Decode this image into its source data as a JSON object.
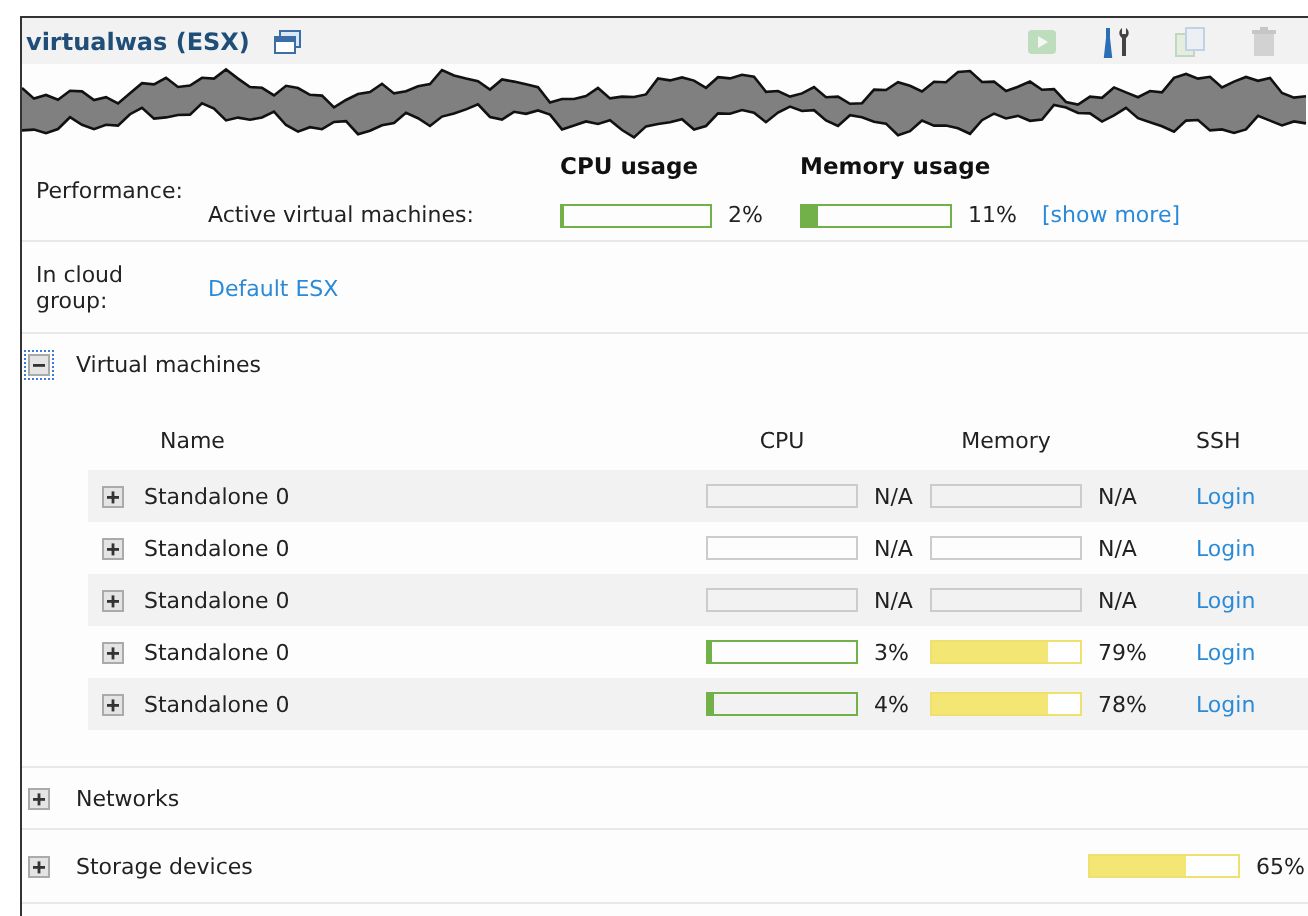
{
  "title": "virtualwas (ESX)",
  "toolbar": [
    {
      "kind": "play",
      "disabled": true
    },
    {
      "kind": "tools",
      "disabled": false
    },
    {
      "kind": "clone",
      "disabled": true
    },
    {
      "kind": "delete",
      "disabled": true
    }
  ],
  "performance": {
    "label": "Performance:",
    "row_label": "Active virtual machines:",
    "cpu": {
      "heading": "CPU usage",
      "level": 0.02,
      "reading": "2%"
    },
    "memory": {
      "heading": "Memory usage",
      "level": 0.11,
      "reading": "11%"
    },
    "link": "[show more]"
  },
  "cloud_group": {
    "label": "In cloud group:",
    "value": "Default ESX"
  },
  "sections": [
    {
      "title": "Virtual machines",
      "expanded": true,
      "table": {
        "columns": [
          "Name",
          "CPU",
          "Memory",
          "SSH"
        ],
        "rows": [
          {
            "name": "Standalone 0",
            "expanded": false,
            "cpu": {
              "reading": "N/A"
            },
            "memory": {
              "reading": "N/A"
            },
            "ssh": "Login"
          },
          {
            "name": "Standalone 0",
            "expanded": false,
            "cpu": {
              "reading": "N/A"
            },
            "memory": {
              "reading": "N/A"
            },
            "ssh": "Login"
          },
          {
            "name": "Standalone 0",
            "expanded": false,
            "cpu": {
              "reading": "N/A"
            },
            "memory": {
              "reading": "N/A"
            },
            "ssh": "Login"
          },
          {
            "name": "Standalone 0",
            "expanded": false,
            "cpu": {
              "level": 0.03,
              "reading": "3%"
            },
            "memory": {
              "level": 0.79,
              "reading": "79%"
            },
            "ssh": "Login"
          },
          {
            "name": "Standalone 0",
            "expanded": false,
            "cpu": {
              "level": 0.04,
              "reading": "4%"
            },
            "memory": {
              "level": 0.78,
              "reading": "78%"
            },
            "ssh": "Login"
          }
        ]
      }
    },
    {
      "title": "Networks",
      "expanded": false
    },
    {
      "title": "Storage devices",
      "expanded": false,
      "usage": {
        "level": 0.65,
        "reading": "65%"
      }
    }
  ]
}
